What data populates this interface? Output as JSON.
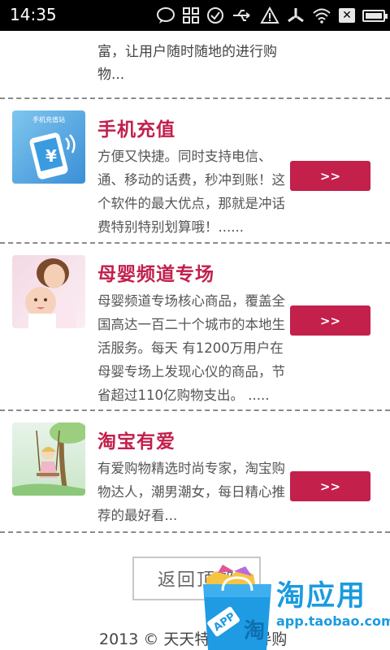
{
  "status_bar": {
    "time": "14:35",
    "icons": [
      "chat-bubble-icon",
      "grid-icon",
      "check-circle-icon",
      "usb-icon",
      "warning-icon",
      "fan-icon",
      "wifi-icon",
      "x-box-icon",
      "battery-icon"
    ]
  },
  "top_item": {
    "text_lines": [
      "富，让用户随时随地的进行购",
      "物..."
    ]
  },
  "items": [
    {
      "title": "手机充值",
      "desc_lines": [
        "方便又快捷。同时支持电信、",
        "通、移动的话费，秒冲到账！这",
        "个软件的最大优点，那就是冲话",
        "费特别特别划算哦！......"
      ],
      "thumb_caption": "手机充值站",
      "button": ">>"
    },
    {
      "title": "母婴频道专场",
      "desc_lines": [
        "母婴频道专场核心商品，覆盖全",
        "国高达一百二十个城市的本地生",
        "活服务。每天 有1200万用户在",
        "母婴专场上发现心仪的商品，节",
        "省超过110亿购物支出。 ....."
      ],
      "button": ">>"
    },
    {
      "title": "淘宝有爱",
      "desc_lines": [
        "有爱购物精选时尚专家，淘宝购",
        "物达人，潮男潮女，每日精心推",
        "荐的最好看..."
      ],
      "button": ">>"
    }
  ],
  "back_to_top": "返回顶部",
  "footer": "2013 © 天天特价手机导购",
  "watermark": {
    "brand": "淘应用",
    "url": "app.taobao.com",
    "bag_label": "APP"
  },
  "colors": {
    "accent": "#c3204c",
    "watermark_blue": "#1b9be0",
    "divider": "#8a8a8a"
  }
}
